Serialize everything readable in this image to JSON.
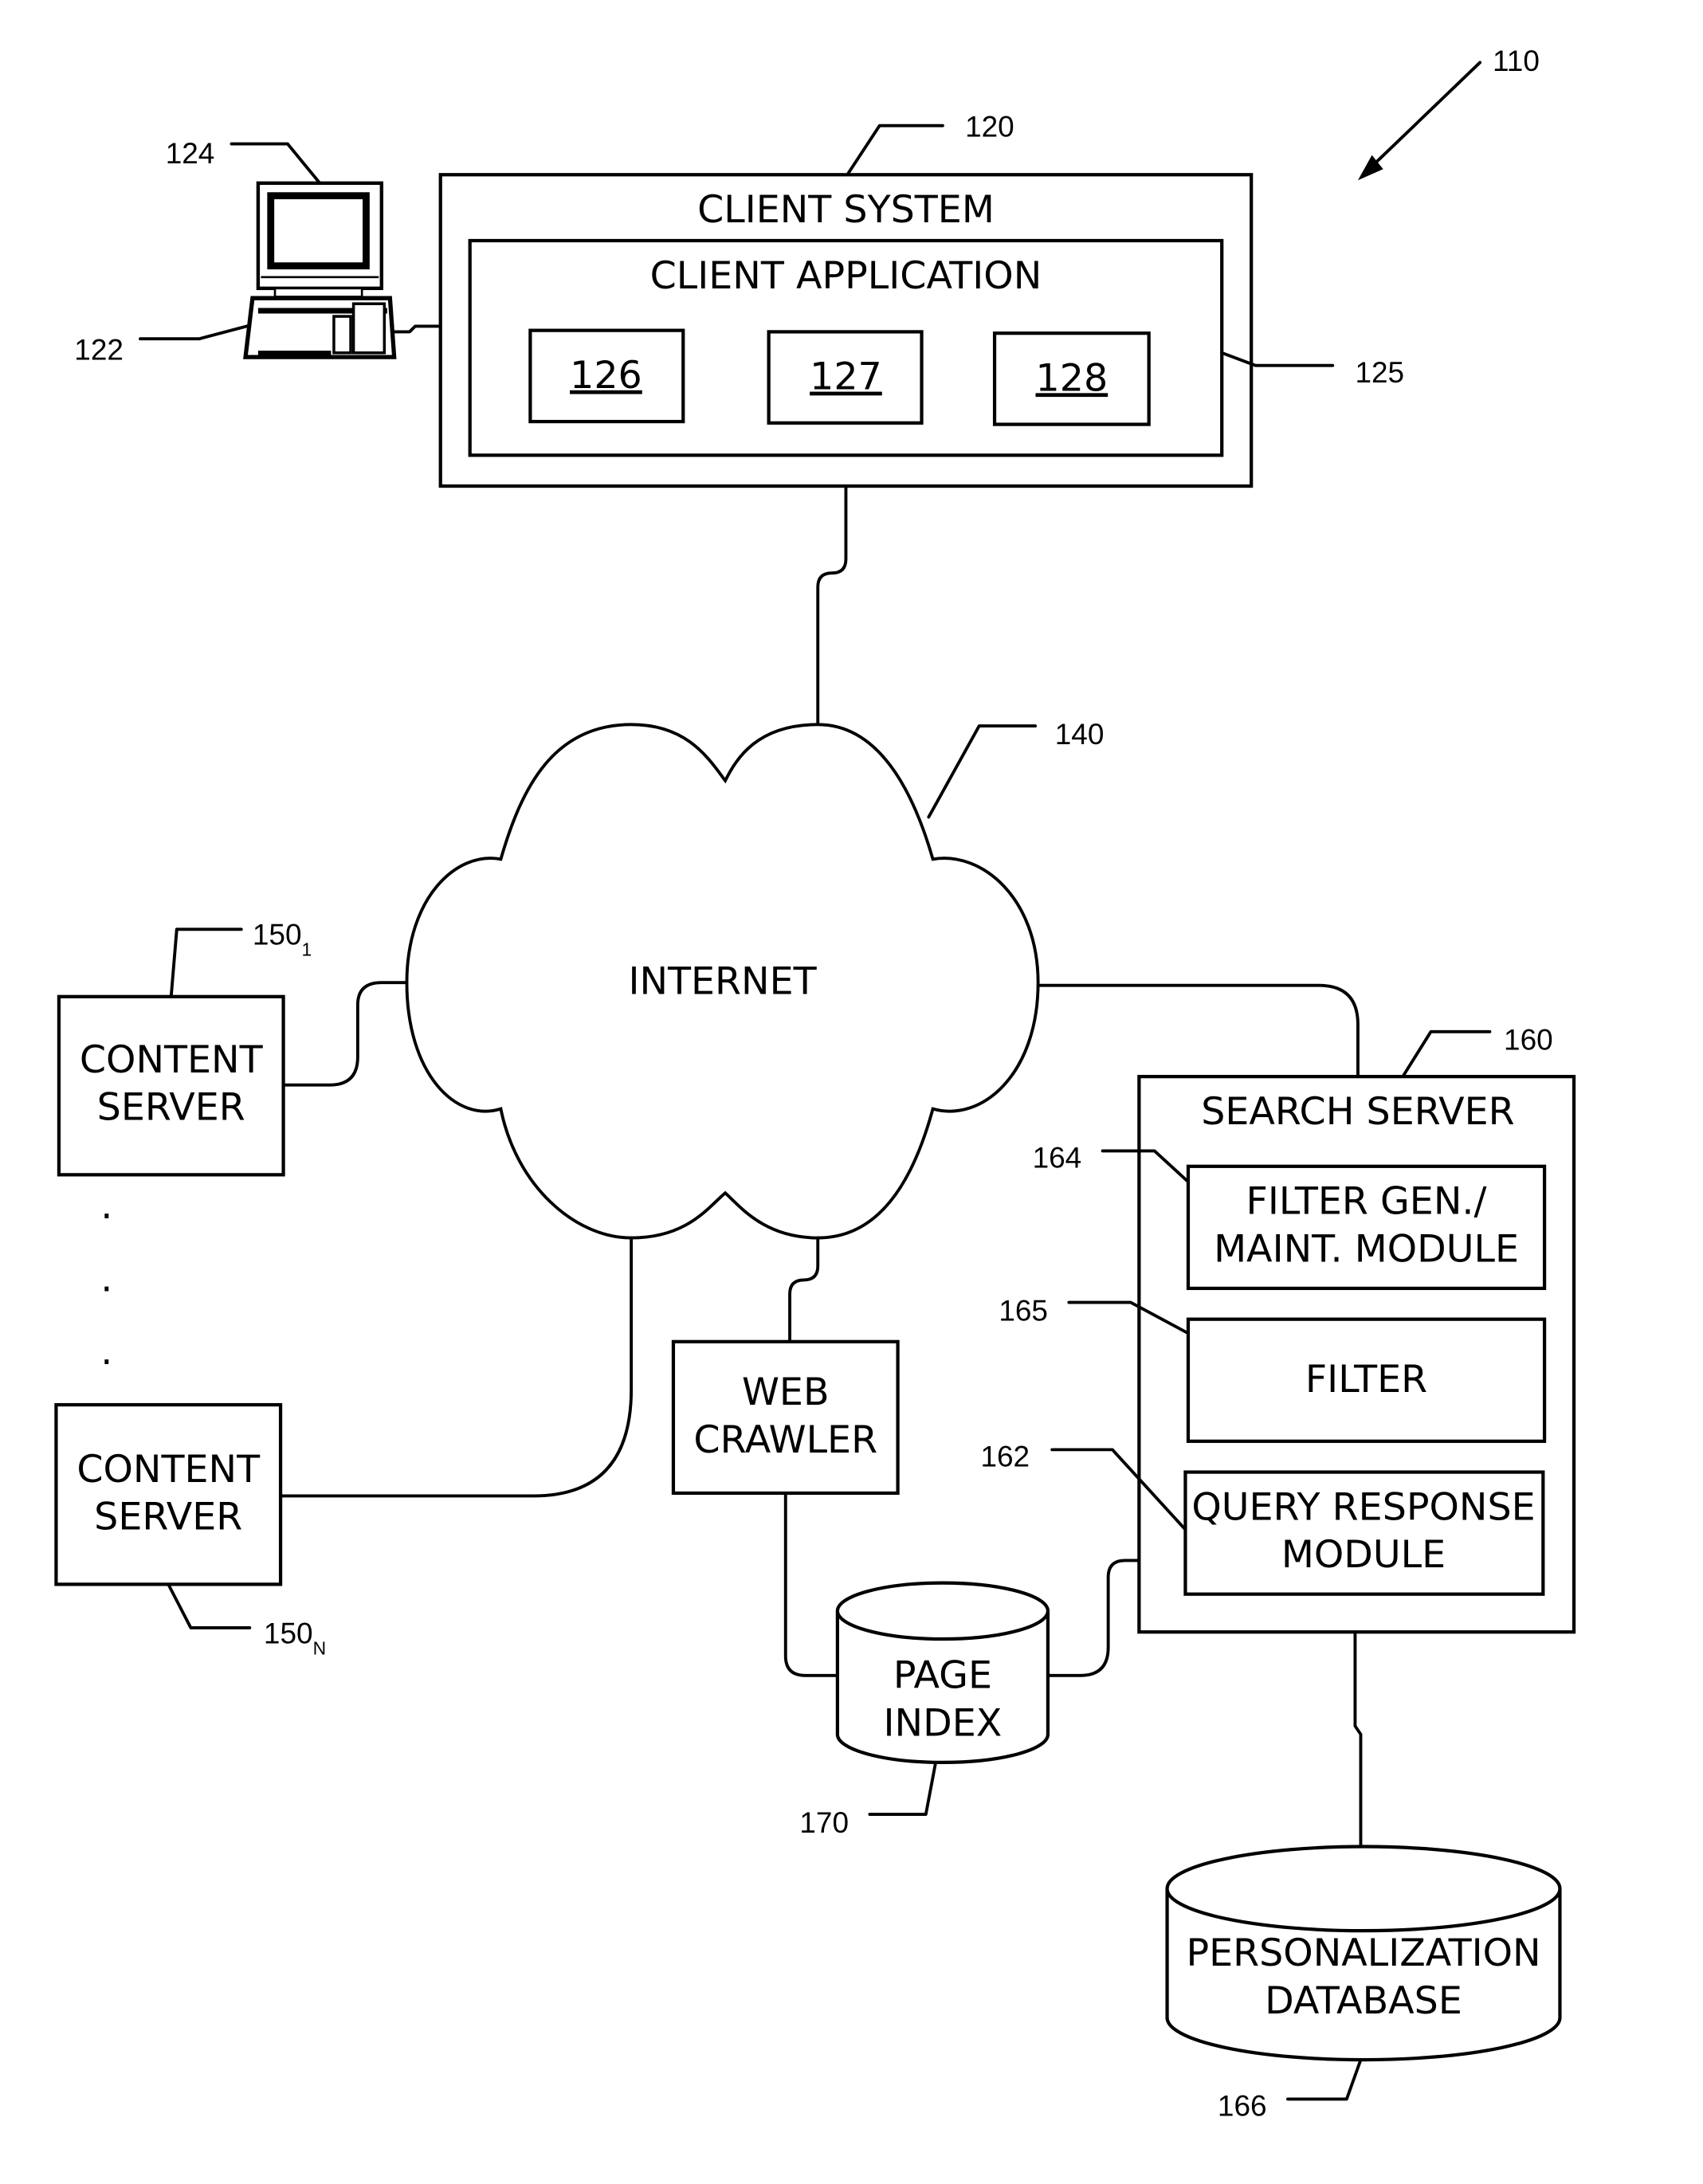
{
  "figure": {
    "ref": "110",
    "client_system": {
      "title": "CLIENT SYSTEM",
      "ref": "120",
      "application": {
        "title": "CLIENT APPLICATION",
        "ref": "125",
        "modules": [
          "126",
          "127",
          "128"
        ]
      },
      "computer_ref": "124",
      "keyboard_ref": "122"
    },
    "internet": {
      "label": "INTERNET",
      "ref": "140"
    },
    "content_servers": [
      {
        "line1": "CONTENT",
        "line2": "SERVER",
        "ref": "150",
        "ref_sub": "1"
      },
      {
        "line1": "CONTENT",
        "line2": "SERVER",
        "ref": "150",
        "ref_sub": "N"
      }
    ],
    "ellipsis": ".",
    "web_crawler": {
      "line1": "WEB",
      "line2": "CRAWLER"
    },
    "page_index": {
      "line1": "PAGE",
      "line2": "INDEX",
      "ref": "170"
    },
    "search_server": {
      "title": "SEARCH SERVER",
      "ref": "160",
      "modules": [
        {
          "line1": "FILTER GEN./",
          "line2": "MAINT. MODULE",
          "ref": "164"
        },
        {
          "line1": "FILTER",
          "line2": "",
          "ref": "165"
        },
        {
          "line1": "QUERY RESPONSE",
          "line2": "MODULE",
          "ref": "162"
        }
      ]
    },
    "personalization_db": {
      "line1": "PERSONALIZATION",
      "line2": "DATABASE",
      "ref": "166"
    }
  }
}
